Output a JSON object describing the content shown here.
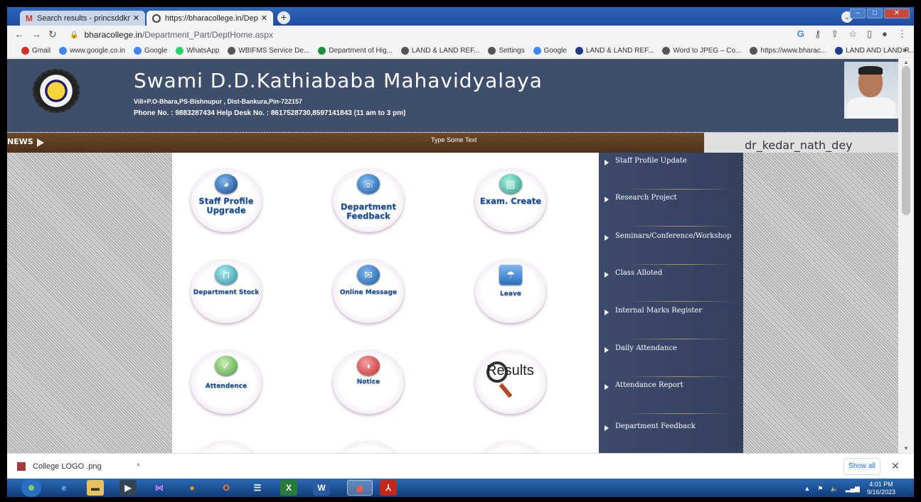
{
  "browser": {
    "tabs": [
      {
        "label": "Search results - princsddkm@gm",
        "active": false
      },
      {
        "label": "https://bharacollege.in/Departm",
        "active": true
      }
    ],
    "url_host": "bharacollege.in",
    "url_path": "/Department_Part/DeptHome.aspx",
    "bookmarks": [
      {
        "label": "Gmail",
        "icon": "gmail-icon",
        "color": "#d93025"
      },
      {
        "label": "www.google.co.in",
        "icon": "google-icon",
        "color": "#4285f4"
      },
      {
        "label": "Google",
        "icon": "google-icon",
        "color": "#4285f4"
      },
      {
        "label": "WhatsApp",
        "icon": "whatsapp-icon",
        "color": "#25d366"
      },
      {
        "label": "WBIFMS Service De...",
        "icon": "globe-icon",
        "color": "#555555"
      },
      {
        "label": "Department of Hig...",
        "icon": "emblem-icon",
        "color": "#1e8e3e"
      },
      {
        "label": "LAND & LAND REF...",
        "icon": "globe-icon",
        "color": "#555555"
      },
      {
        "label": "Settings",
        "icon": "gear-icon",
        "color": "#555555"
      },
      {
        "label": "Google",
        "icon": "google-icon",
        "color": "#4285f4"
      },
      {
        "label": "LAND & LAND REF...",
        "icon": "cloud-icon",
        "color": "#1a3a8a"
      },
      {
        "label": "Word to JPEG – Co...",
        "icon": "globe-icon",
        "color": "#555555"
      },
      {
        "label": "https://www.bharac...",
        "icon": "globe-icon",
        "color": "#555555"
      },
      {
        "label": "LAND AND LAND R...",
        "icon": "cloud-icon",
        "color": "#1a3a8a"
      }
    ],
    "bookmarks_more": "»"
  },
  "header": {
    "college_name": "Swami D.D.Kathiababa Mahavidyalaya",
    "address": "Vill+P.O-Bhara,PS-Bishnupur , Dist-Bankura,Pin-722157",
    "phone": "Phone No. : 9883287434    Help Desk No. : 8617528730,8597141843 (11 am to 3 pm)"
  },
  "news": {
    "label": "NEWS",
    "text": "Type Some Text"
  },
  "user": {
    "name": "dr_kedar_nath_dey"
  },
  "tiles": [
    {
      "label": "Staff Profile Upgrade",
      "icon": "profile-icon",
      "size": "big"
    },
    {
      "label": "Department Feedback",
      "icon": "feedback-icon",
      "size": "big"
    },
    {
      "label": "Exam. Create",
      "icon": "exam-icon",
      "size": "big"
    },
    {
      "label": "Department Stock",
      "icon": "stock-basket-icon",
      "size": "small"
    },
    {
      "label": "Online Message",
      "icon": "envelope-icon",
      "size": "small"
    },
    {
      "label": "Leave",
      "icon": "leave-icon",
      "size": "small"
    },
    {
      "label": "Attendence",
      "icon": "attendance-icon",
      "size": "small"
    },
    {
      "label": "Notice",
      "icon": "notice-icon",
      "size": "small"
    },
    {
      "label": "Results",
      "icon": "results-magnifier-icon",
      "size": "results"
    }
  ],
  "menu": [
    "Staff Profile Update",
    "Research Project",
    "Seminars/Conference/Workshop",
    "Class Alloted",
    "Internal Marks Register",
    "Daily Attendance",
    "Attendance Report",
    "Department Feedback"
  ],
  "downloads": {
    "file": "College LOGO .png",
    "show_all": "Show all"
  },
  "taskbar": {
    "time": "4:01 PM",
    "date": "9/16/2023"
  }
}
